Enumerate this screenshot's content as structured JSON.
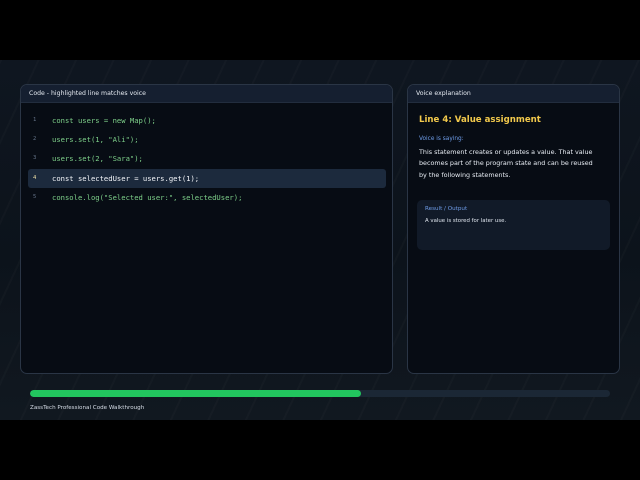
{
  "code_panel": {
    "title": "Code - highlighted line matches voice",
    "active_line": 4,
    "lines": [
      {
        "number": "1",
        "text": "const users = new Map();"
      },
      {
        "number": "2",
        "text": "users.set(1, \"Ali\");"
      },
      {
        "number": "3",
        "text": "users.set(2, \"Sara\");"
      },
      {
        "number": "4",
        "text": "const selectedUser = users.get(1);"
      },
      {
        "number": "5",
        "text": "console.log(\"Selected user:\", selectedUser);"
      }
    ]
  },
  "voice_panel": {
    "title": "Voice explanation",
    "heading": "Line 4: Value assignment",
    "saying_label": "Voice is saying:",
    "explanation": "This statement creates or updates a value. That value becomes part of the program state and can be reused by the following statements.",
    "output_label": "Result / Output",
    "output_text": "A value is stored for later use."
  },
  "progress": {
    "fraction": 0.57
  },
  "footer": {
    "text": "ZassTech Professional Code Walkthrough"
  },
  "colors": {
    "accent_progress": "#22c55e",
    "heading": "#f2c94c",
    "code_text": "#7ed08a",
    "label_blue": "#6e9ce8"
  }
}
